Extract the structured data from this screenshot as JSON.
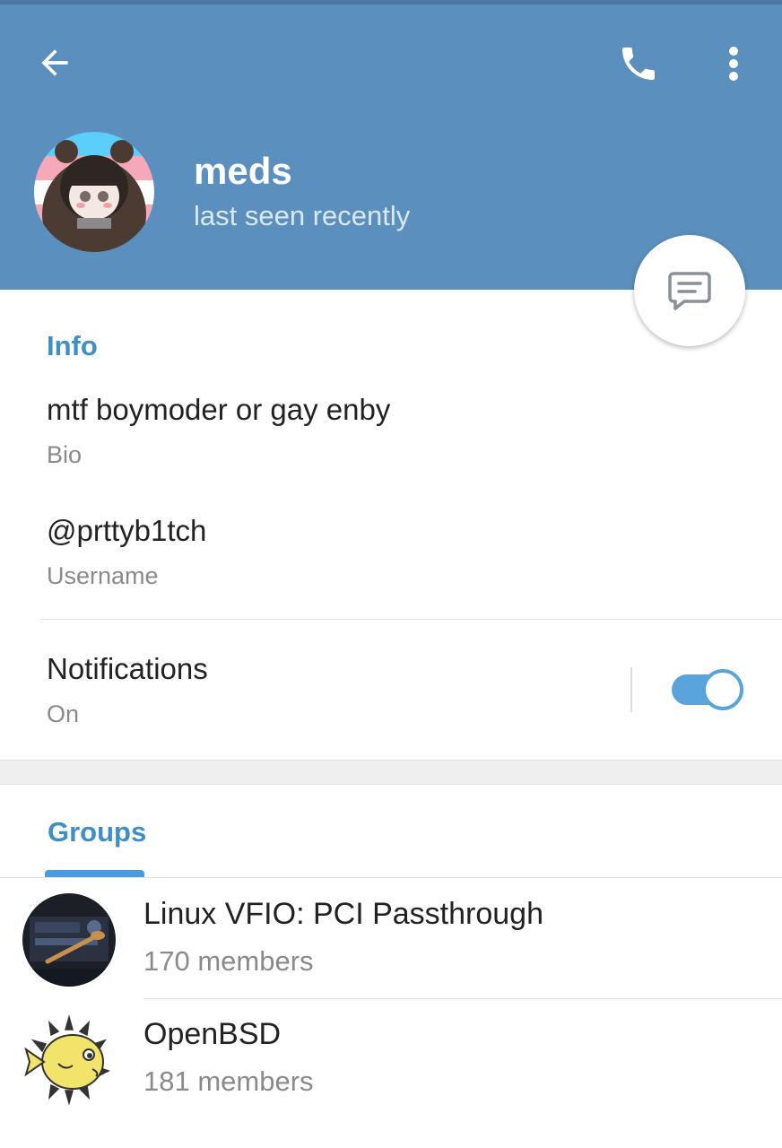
{
  "profile": {
    "name": "meds",
    "status": "last seen recently"
  },
  "info": {
    "section_title": "Info",
    "bio_value": "mtf boymoder or gay enby",
    "bio_label": "Bio",
    "username_value": "@prttyb1tch",
    "username_label": "Username",
    "notifications_label": "Notifications",
    "notifications_value": "On",
    "notifications_enabled": true
  },
  "groups": {
    "section_title": "Groups",
    "items": [
      {
        "name": "Linux VFIO: PCI Passthrough",
        "members": "170 members"
      },
      {
        "name": "OpenBSD",
        "members": "181 members"
      }
    ]
  },
  "icons": {
    "back": "arrow-left-icon",
    "call": "phone-icon",
    "more": "more-vertical-icon",
    "message": "message-icon"
  },
  "colors": {
    "header": "#5a8fbe",
    "accent": "#3e8fc8",
    "toggle": "#5aa4dc"
  }
}
